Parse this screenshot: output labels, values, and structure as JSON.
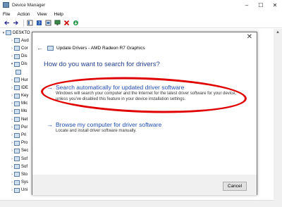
{
  "window": {
    "title": "Device Manager",
    "controls": {
      "minimize": "–",
      "maximize": "☐",
      "close": "✕"
    }
  },
  "menu": [
    "File",
    "Action",
    "View",
    "Help"
  ],
  "toolbar": {
    "icons": [
      "back-arrow",
      "forward-arrow",
      "properties",
      "help",
      "scan",
      "monitor",
      "uninstall-x",
      "update-down"
    ]
  },
  "tree": {
    "root": "DESKTO",
    "items": [
      {
        "label": "Aud",
        "expanded": false
      },
      {
        "label": "Cor",
        "expanded": false
      },
      {
        "label": "Dis",
        "expanded": false
      },
      {
        "label": "Dis",
        "expanded": true
      },
      {
        "label": "",
        "child": true
      },
      {
        "label": "Hur",
        "expanded": false
      },
      {
        "label": "IDE",
        "expanded": false
      },
      {
        "label": "Key",
        "expanded": false
      },
      {
        "label": "Mic",
        "expanded": false
      },
      {
        "label": "Mo",
        "expanded": false
      },
      {
        "label": "Net",
        "expanded": false
      },
      {
        "label": "Por",
        "expanded": false
      },
      {
        "label": "Pri",
        "expanded": false
      },
      {
        "label": "Pro",
        "expanded": false
      },
      {
        "label": "Sec",
        "expanded": false
      },
      {
        "label": "Sof",
        "expanded": false
      },
      {
        "label": "Sof",
        "expanded": false
      },
      {
        "label": "Sto",
        "expanded": false
      },
      {
        "label": "Sys",
        "expanded": false
      },
      {
        "label": "Uni",
        "expanded": false
      }
    ]
  },
  "dialog": {
    "close": "✕",
    "breadcrumb": "Update Drivers - AMD Radeon R7 Graphics",
    "question": "How do you want to search for drivers?",
    "option1": {
      "title": "Search automatically for updated driver software",
      "description": "Windows will search your computer and the Internet for the latest driver software for your device, unless you've disabled this feature in your device installation settings."
    },
    "option2": {
      "title": "Browse my computer for driver software",
      "description": "Locate and install driver software manually."
    },
    "cancel_label": "Cancel"
  },
  "colors": {
    "link": "#1f4fb0",
    "heading": "#1f3f8f",
    "annotation": "#e00000"
  }
}
